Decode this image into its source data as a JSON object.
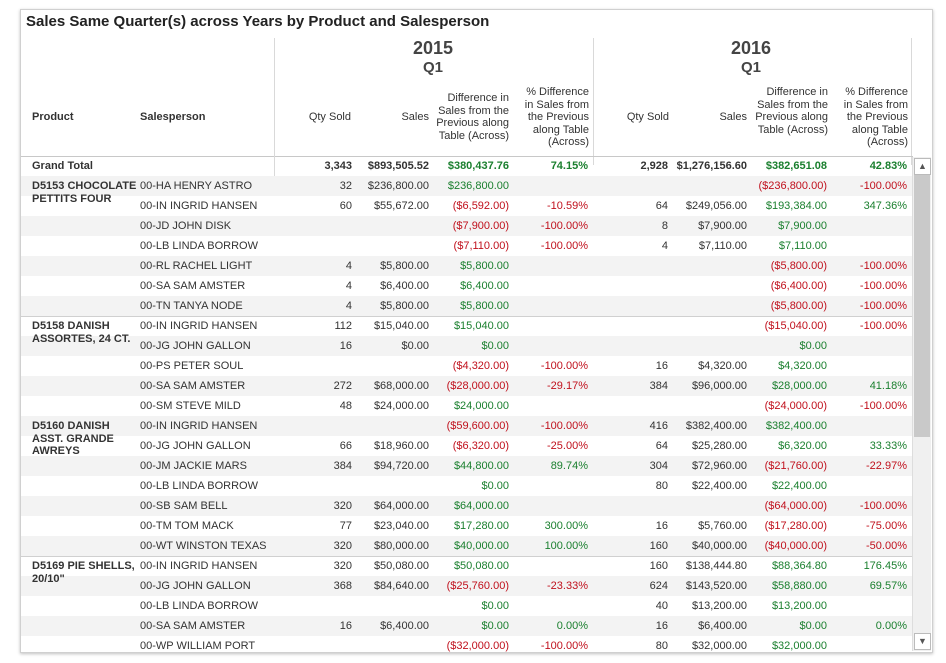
{
  "title": "Sales Same Quarter(s) across Years by Product and Salesperson",
  "years": [
    {
      "year": "2015",
      "quarter": "Q1"
    },
    {
      "year": "2016",
      "quarter": "Q1"
    }
  ],
  "row_headers": {
    "product": "Product",
    "salesperson": "Salesperson"
  },
  "measure_headers": {
    "qty": "Qty Sold",
    "sales": "Sales",
    "diff": "Difference in Sales from the Previous along Table (Across)",
    "pct": "% Difference in Sales from the Previous along Table (Across)"
  },
  "grand_total": {
    "label": "Grand Total",
    "y2015": {
      "qty": "3,343",
      "sales": "$893,505.52",
      "diff": "$380,437.76",
      "pct": "74.15%"
    },
    "y2016": {
      "qty": "2,928",
      "sales": "$1,276,156.60",
      "diff": "$382,651.08",
      "pct": "42.83%"
    }
  },
  "groups": [
    {
      "product": "D5153 CHOCOLATE PETTITS FOUR",
      "rows": [
        {
          "sp": "00-HA  HENRY ASTRO",
          "q1": "32",
          "s1": "$236,800.00",
          "d1": "$236,800.00",
          "p1": "",
          "q2": "",
          "s2": "",
          "d2": "($236,800.00)",
          "p2": "-100.00%"
        },
        {
          "sp": "00-IN  INGRID HANSEN",
          "q1": "60",
          "s1": "$55,672.00",
          "d1": "($6,592.00)",
          "p1": "-10.59%",
          "q2": "64",
          "s2": "$249,056.00",
          "d2": "$193,384.00",
          "p2": "347.36%"
        },
        {
          "sp": "00-JD  JOHN DISK",
          "q1": "",
          "s1": "",
          "d1": "($7,900.00)",
          "p1": "-100.00%",
          "q2": "8",
          "s2": "$7,900.00",
          "d2": "$7,900.00",
          "p2": ""
        },
        {
          "sp": "00-LB  LINDA BORROW",
          "q1": "",
          "s1": "",
          "d1": "($7,110.00)",
          "p1": "-100.00%",
          "q2": "4",
          "s2": "$7,110.00",
          "d2": "$7,110.00",
          "p2": ""
        },
        {
          "sp": "00-RL  RACHEL LIGHT",
          "q1": "4",
          "s1": "$5,800.00",
          "d1": "$5,800.00",
          "p1": "",
          "q2": "",
          "s2": "",
          "d2": "($5,800.00)",
          "p2": "-100.00%"
        },
        {
          "sp": "00-SA  SAM AMSTER",
          "q1": "4",
          "s1": "$6,400.00",
          "d1": "$6,400.00",
          "p1": "",
          "q2": "",
          "s2": "",
          "d2": "($6,400.00)",
          "p2": "-100.00%"
        },
        {
          "sp": "00-TN  TANYA NODE",
          "q1": "4",
          "s1": "$5,800.00",
          "d1": "$5,800.00",
          "p1": "",
          "q2": "",
          "s2": "",
          "d2": "($5,800.00)",
          "p2": "-100.00%"
        }
      ]
    },
    {
      "product": "D5158  DANISH ASSORTES, 24 CT.",
      "rows": [
        {
          "sp": "00-IN  INGRID HANSEN",
          "q1": "112",
          "s1": "$15,040.00",
          "d1": "$15,040.00",
          "p1": "",
          "q2": "",
          "s2": "",
          "d2": "($15,040.00)",
          "p2": "-100.00%"
        },
        {
          "sp": "00-JG  JOHN GALLON",
          "q1": "16",
          "s1": "$0.00",
          "d1": "$0.00",
          "p1": "",
          "q2": "",
          "s2": "",
          "d2": "$0.00",
          "p2": ""
        },
        {
          "sp": "00-PS  PETER SOUL",
          "q1": "",
          "s1": "",
          "d1": "($4,320.00)",
          "p1": "-100.00%",
          "q2": "16",
          "s2": "$4,320.00",
          "d2": "$4,320.00",
          "p2": ""
        },
        {
          "sp": "00-SA  SAM AMSTER",
          "q1": "272",
          "s1": "$68,000.00",
          "d1": "($28,000.00)",
          "p1": "-29.17%",
          "q2": "384",
          "s2": "$96,000.00",
          "d2": "$28,000.00",
          "p2": "41.18%"
        },
        {
          "sp": "00-SM  STEVE MILD",
          "q1": "48",
          "s1": "$24,000.00",
          "d1": "$24,000.00",
          "p1": "",
          "q2": "",
          "s2": "",
          "d2": "($24,000.00)",
          "p2": "-100.00%"
        }
      ]
    },
    {
      "product": "D5160  DANISH ASST. GRANDE AWREYS",
      "rows": [
        {
          "sp": "00-IN  INGRID HANSEN",
          "q1": "",
          "s1": "",
          "d1": "($59,600.00)",
          "p1": "-100.00%",
          "q2": "416",
          "s2": "$382,400.00",
          "d2": "$382,400.00",
          "p2": ""
        },
        {
          "sp": "00-JG  JOHN GALLON",
          "q1": "66",
          "s1": "$18,960.00",
          "d1": "($6,320.00)",
          "p1": "-25.00%",
          "q2": "64",
          "s2": "$25,280.00",
          "d2": "$6,320.00",
          "p2": "33.33%"
        },
        {
          "sp": "00-JM  JACKIE MARS",
          "q1": "384",
          "s1": "$94,720.00",
          "d1": "$44,800.00",
          "p1": "89.74%",
          "q2": "304",
          "s2": "$72,960.00",
          "d2": "($21,760.00)",
          "p2": "-22.97%"
        },
        {
          "sp": "00-LB  LINDA BORROW",
          "q1": "",
          "s1": "",
          "d1": "$0.00",
          "p1": "",
          "q2": "80",
          "s2": "$22,400.00",
          "d2": "$22,400.00",
          "p2": ""
        },
        {
          "sp": "00-SB  SAM BELL",
          "q1": "320",
          "s1": "$64,000.00",
          "d1": "$64,000.00",
          "p1": "",
          "q2": "",
          "s2": "",
          "d2": "($64,000.00)",
          "p2": "-100.00%"
        },
        {
          "sp": "00-TM  TOM MACK",
          "q1": "77",
          "s1": "$23,040.00",
          "d1": "$17,280.00",
          "p1": "300.00%",
          "q2": "16",
          "s2": "$5,760.00",
          "d2": "($17,280.00)",
          "p2": "-75.00%"
        },
        {
          "sp": "00-WT  WINSTON TEXAS",
          "q1": "320",
          "s1": "$80,000.00",
          "d1": "$40,000.00",
          "p1": "100.00%",
          "q2": "160",
          "s2": "$40,000.00",
          "d2": "($40,000.00)",
          "p2": "-50.00%"
        }
      ]
    },
    {
      "product": "D5169  PIE SHELLS, 20/10\"",
      "rows": [
        {
          "sp": "00-IN  INGRID HANSEN",
          "q1": "320",
          "s1": "$50,080.00",
          "d1": "$50,080.00",
          "p1": "",
          "q2": "160",
          "s2": "$138,444.80",
          "d2": "$88,364.80",
          "p2": "176.45%"
        },
        {
          "sp": "00-JG  JOHN GALLON",
          "q1": "368",
          "s1": "$84,640.00",
          "d1": "($25,760.00)",
          "p1": "-23.33%",
          "q2": "624",
          "s2": "$143,520.00",
          "d2": "$58,880.00",
          "p2": "69.57%"
        },
        {
          "sp": "00-LB  LINDA BORROW",
          "q1": "",
          "s1": "",
          "d1": "$0.00",
          "p1": "",
          "q2": "40",
          "s2": "$13,200.00",
          "d2": "$13,200.00",
          "p2": ""
        },
        {
          "sp": "00-SA  SAM AMSTER",
          "q1": "16",
          "s1": "$6,400.00",
          "d1": "$0.00",
          "p1": "0.00%",
          "q2": "16",
          "s2": "$6,400.00",
          "d2": "$0.00",
          "p2": "0.00%"
        },
        {
          "sp": "00-WP  WILLIAM PORT",
          "q1": "",
          "s1": "",
          "d1": "($32,000.00)",
          "p1": "-100.00%",
          "q2": "80",
          "s2": "$32,000.00",
          "d2": "$32,000.00",
          "p2": ""
        }
      ]
    }
  ],
  "colors": {
    "positive": "#1a7f2e",
    "negative": "#c0101c",
    "band": "#f3f3f3"
  }
}
